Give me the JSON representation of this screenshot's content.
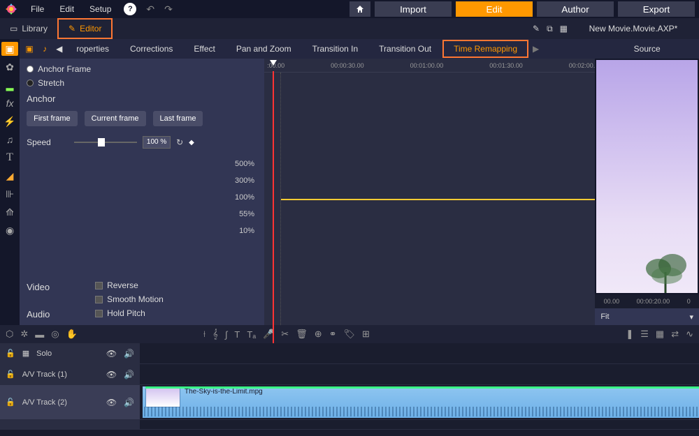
{
  "menu": {
    "file": "File",
    "edit": "Edit",
    "setup": "Setup"
  },
  "top_buttons": {
    "import": "Import",
    "edit": "Edit",
    "author": "Author",
    "export": "Export"
  },
  "tabs": {
    "library": "Library",
    "editor": "Editor"
  },
  "project_name": "New Movie.Movie.AXP*",
  "sub_tabs": [
    "roperties",
    "Corrections",
    "Effect",
    "Pan and Zoom",
    "Transition In",
    "Transition Out",
    "Time Remapping"
  ],
  "panel": {
    "anchor_frame": "Anchor Frame",
    "stretch": "Stretch",
    "anchor": "Anchor",
    "first_frame": "First frame",
    "current_frame": "Current frame",
    "last_frame": "Last frame",
    "speed": "Speed",
    "speed_value": "100 %",
    "pct_scale": [
      "500%",
      "300%",
      "100%",
      "55%",
      "10%"
    ],
    "video": "Video",
    "audio": "Audio",
    "reverse": "Reverse",
    "smooth_motion": "Smooth Motion",
    "hold_pitch": "Hold Pitch"
  },
  "ruler": [
    ":00.00",
    "00:00:30.00",
    "00:01:00.00",
    "00:01:30.00",
    "00:02:00."
  ],
  "source": {
    "label": "Source",
    "ruler": [
      "00.00",
      "00:00:20.00",
      "0"
    ],
    "fit": "Fit"
  },
  "tracks": {
    "solo": "Solo",
    "av1": "A/V Track (1)",
    "av2": "A/V Track (2)",
    "clip_name": "The-Sky-is-the-Limit.mpg"
  }
}
